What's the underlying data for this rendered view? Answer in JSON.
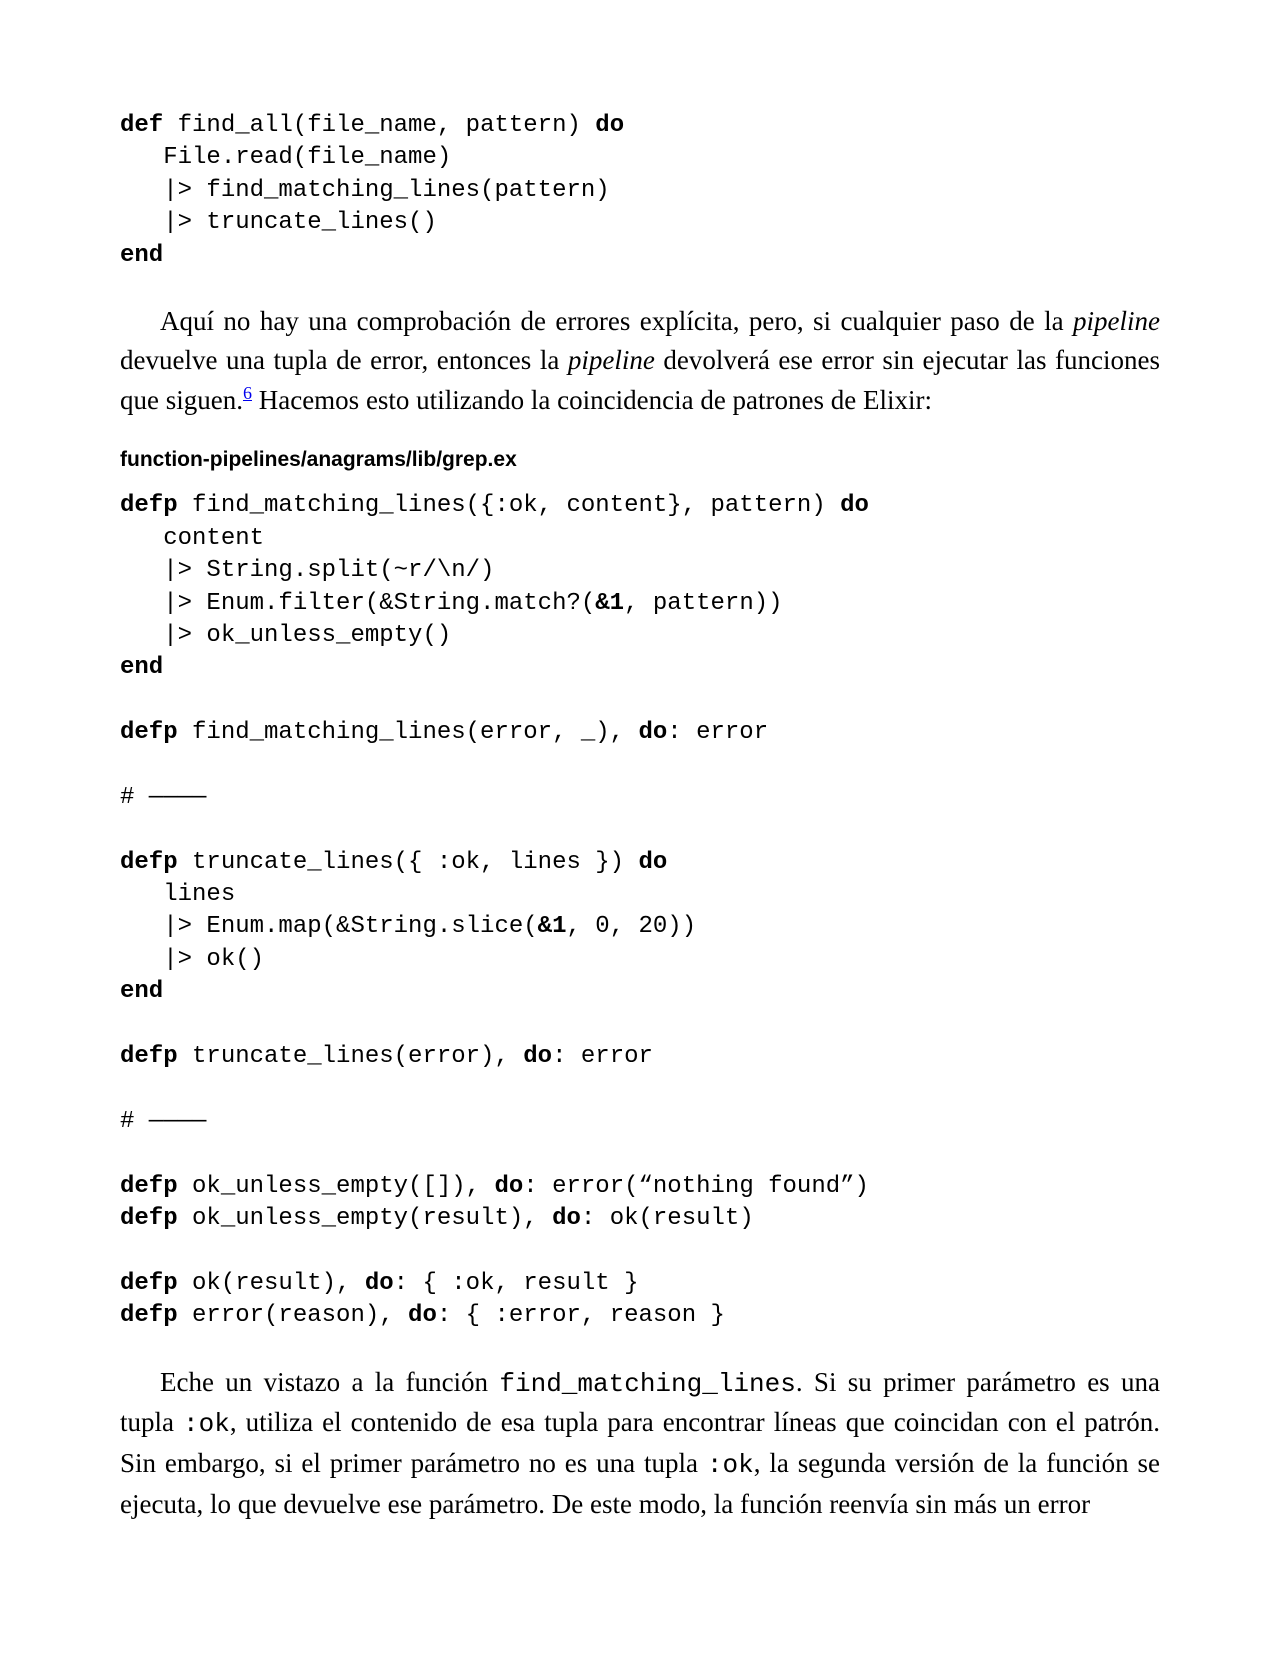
{
  "code1": {
    "l1a": "def",
    "l1b": " find_all(file_name, pattern) ",
    "l1c": "do",
    "l2": "   File.read(file_name)",
    "l3": "   |> find_matching_lines(pattern)",
    "l4": "   |> truncate_lines()",
    "l5": "end"
  },
  "para1": {
    "t1": "Aquí no hay una comprobación de errores explícita, pero, si cualquier paso de la ",
    "t2": "pipeline",
    "t3": " devuelve una tupla de error, entonces la ",
    "t4": "pipeline",
    "t5": " devolverá ese error sin ejecutar las funciones que siguen.",
    "fn": "6",
    "t6": " Hacemos esto utilizando la coincidencia de patrones de Elixir:"
  },
  "file_label": "function-pipelines/anagrams/lib/grep.ex",
  "code2": {
    "l1a": "defp",
    "l1b": " find_matching_lines({:ok, content}, pattern) ",
    "l1c": "do",
    "l2": "   content",
    "l3": "   |> String.split(~r/\\n/)",
    "l4a": "   |> Enum.filter(&String.match?(",
    "l4b": "&1",
    "l4c": ", pattern))",
    "l5": "   |> ok_unless_empty()",
    "l6": "end",
    "l8a": "defp",
    "l8b": " find_matching_lines(error, _), ",
    "l8c": "do",
    "l8d": ": error",
    "l10": "# ————",
    "l12a": "defp",
    "l12b": " truncate_lines({ :ok, lines }) ",
    "l12c": "do",
    "l13": "   lines",
    "l14a": "   |> Enum.map(&String.slice(",
    "l14b": "&1",
    "l14c": ", 0, 20))",
    "l15": "   |> ok()",
    "l16": "end",
    "l18a": "defp",
    "l18b": " truncate_lines(error), ",
    "l18c": "do",
    "l18d": ": error",
    "l20": "# ————",
    "l22a": "defp",
    "l22b": " ok_unless_empty([]), ",
    "l22c": "do",
    "l22d": ": error(“nothing found”)",
    "l23a": "defp",
    "l23b": " ok_unless_empty(result), ",
    "l23c": "do",
    "l23d": ": ok(result)",
    "l25a": "defp",
    "l25b": " ok(result), ",
    "l25c": "do",
    "l25d": ": { :ok, result }",
    "l26a": "defp",
    "l26b": " error(reason), ",
    "l26c": "do",
    "l26d": ": { :error, reason }"
  },
  "para2": {
    "t1": "Eche un vistazo a la función ",
    "c1": "find_matching_lines",
    "t2": ". Si su primer parámetro es una tupla ",
    "c2": ":ok",
    "t3": ", utiliza el contenido de esa tupla para encontrar líneas que coincidan con el patrón. Sin embargo, si el primer parámetro no es una tupla ",
    "c3": ":ok",
    "t4": ", la segunda versión de la función se ejecuta, lo que devuelve ese parámetro. De este modo, la función reenvía sin más un error"
  }
}
